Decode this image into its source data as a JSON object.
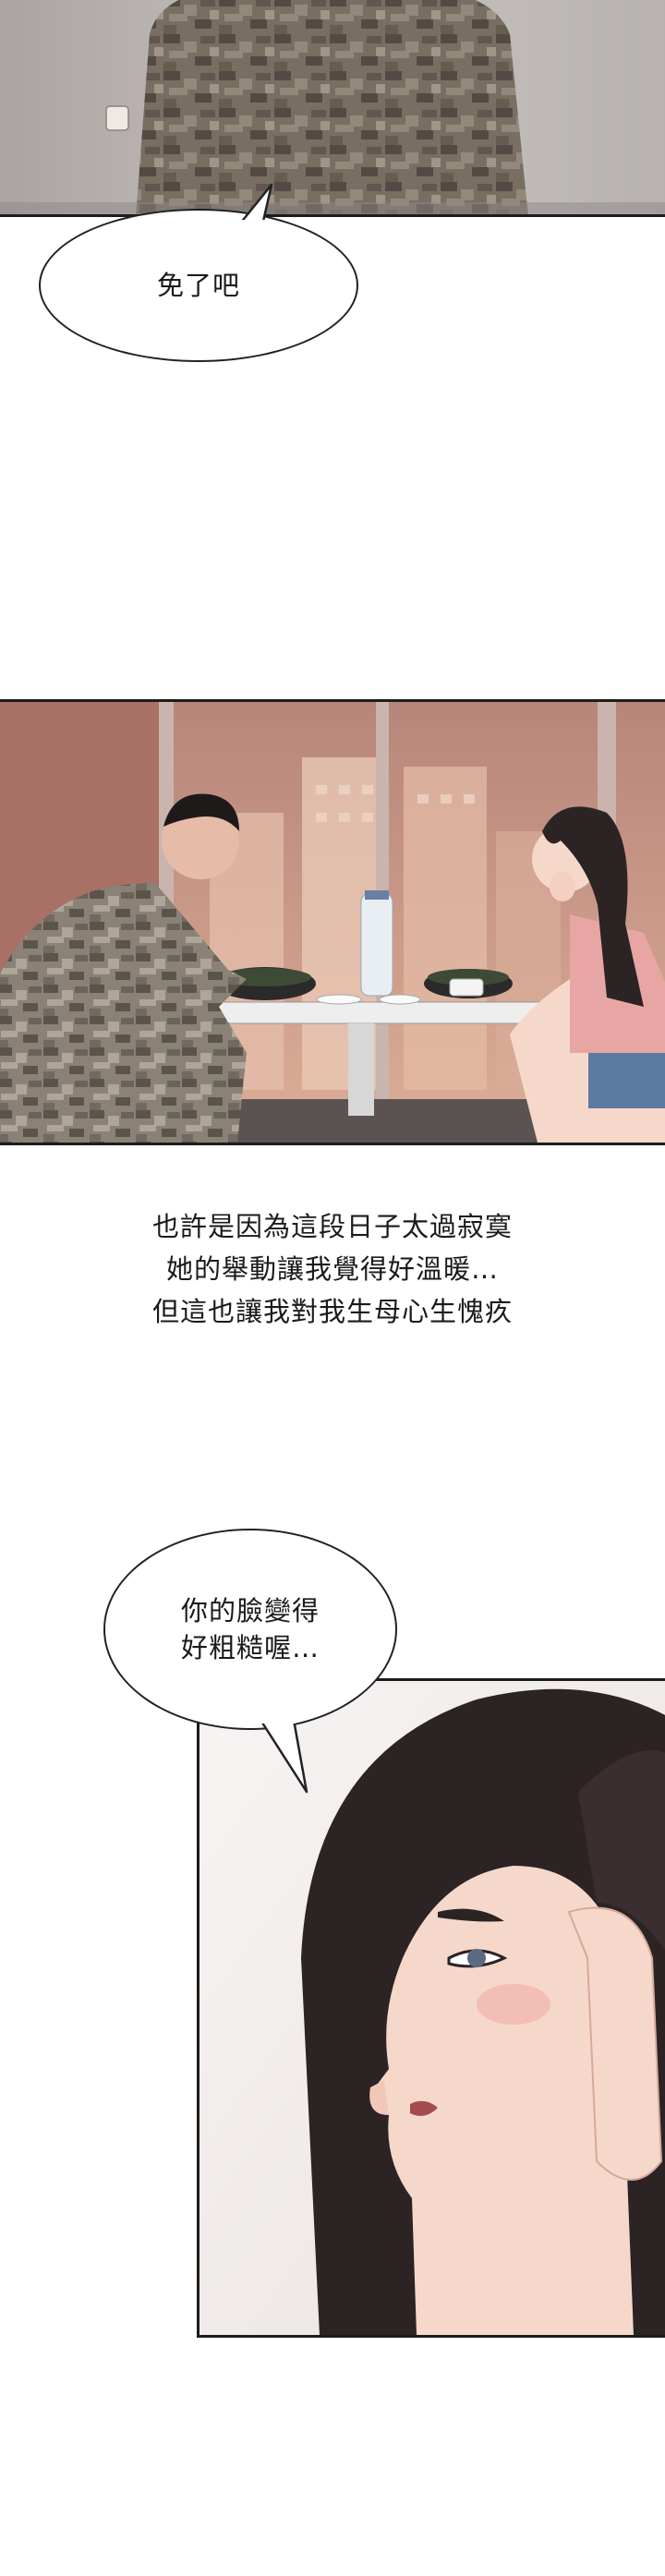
{
  "bubbles": {
    "first": {
      "line1": "免了吧"
    },
    "second": {
      "line1": "你的臉變得",
      "line2": "好粗糙喔…"
    }
  },
  "narration": {
    "line1": "也許是因為這段日子太過寂寞",
    "line2": "她的舉動讓我覺得好溫暖…",
    "line3": "但這也讓我對我生母心生愧疚"
  },
  "colors": {
    "camo_dark": "#3f3e3a",
    "camo_mid": "#6b6a5e",
    "camo_light": "#8c8a7c",
    "sky_warm": "#c99986",
    "wall_pink": "#b98477",
    "hair": "#2b2324",
    "skin": "#f6d8cb",
    "border": "#1c1c1c"
  }
}
